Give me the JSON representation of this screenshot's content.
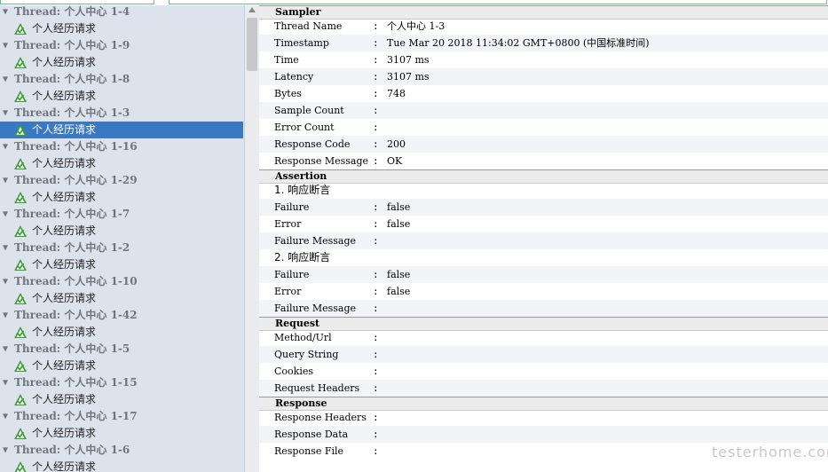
{
  "tree": {
    "rows": [
      {
        "type": "thread",
        "label": "Thread: 个人中心 1-4"
      },
      {
        "type": "request",
        "label": "个人经历请求"
      },
      {
        "type": "thread",
        "label": "Thread: 个人中心 1-9"
      },
      {
        "type": "request",
        "label": "个人经历请求"
      },
      {
        "type": "thread",
        "label": "Thread: 个人中心 1-8"
      },
      {
        "type": "request",
        "label": "个人经历请求"
      },
      {
        "type": "thread",
        "label": "Thread: 个人中心 1-3"
      },
      {
        "type": "request",
        "label": "个人经历请求",
        "selected": true
      },
      {
        "type": "thread",
        "label": "Thread: 个人中心 1-16"
      },
      {
        "type": "request",
        "label": "个人经历请求"
      },
      {
        "type": "thread",
        "label": "Thread: 个人中心 1-29"
      },
      {
        "type": "request",
        "label": "个人经历请求"
      },
      {
        "type": "thread",
        "label": "Thread: 个人中心 1-7"
      },
      {
        "type": "request",
        "label": "个人经历请求"
      },
      {
        "type": "thread",
        "label": "Thread: 个人中心 1-2"
      },
      {
        "type": "request",
        "label": "个人经历请求"
      },
      {
        "type": "thread",
        "label": "Thread: 个人中心 1-10"
      },
      {
        "type": "request",
        "label": "个人经历请求"
      },
      {
        "type": "thread",
        "label": "Thread: 个人中心 1-42"
      },
      {
        "type": "request",
        "label": "个人经历请求"
      },
      {
        "type": "thread",
        "label": "Thread: 个人中心 1-5"
      },
      {
        "type": "request",
        "label": "个人经历请求"
      },
      {
        "type": "thread",
        "label": "Thread: 个人中心 1-15"
      },
      {
        "type": "request",
        "label": "个人经历请求"
      },
      {
        "type": "thread",
        "label": "Thread: 个人中心 1-17"
      },
      {
        "type": "request",
        "label": "个人经历请求"
      },
      {
        "type": "thread",
        "label": "Thread: 个人中心 1-6"
      },
      {
        "type": "request",
        "label": "个人经历请求"
      }
    ],
    "icons": {
      "thread": "collapse-arrow-icon",
      "request": "sample-success-icon"
    },
    "colors": {
      "selected_bg": "#3a78c2",
      "panel_bg": "#dde3ec",
      "success_icon": "#3f9b3a"
    }
  },
  "details": {
    "sections": [
      {
        "title": "Sampler",
        "rows": [
          {
            "key": "Thread Name",
            "value": "个人中心 1-3"
          },
          {
            "key": "Timestamp",
            "value": "Tue Mar 20 2018 11:34:02 GMT+0800 (中国标准时间)"
          },
          {
            "key": "Time",
            "value": "3107 ms"
          },
          {
            "key": "Latency",
            "value": "3107 ms"
          },
          {
            "key": "Bytes",
            "value": "748"
          },
          {
            "key": "Sample Count",
            "value": ""
          },
          {
            "key": "Error Count",
            "value": ""
          },
          {
            "key": "Response Code",
            "value": "200"
          },
          {
            "key": "Response Message",
            "value": "OK"
          }
        ]
      },
      {
        "title": "Assertion",
        "rows": [
          {
            "sub": "1. 响应断言"
          },
          {
            "key": "Failure",
            "value": "false"
          },
          {
            "key": "Error",
            "value": "false"
          },
          {
            "key": "Failure Message",
            "value": ""
          },
          {
            "sub": "2. 响应断言"
          },
          {
            "key": "Failure",
            "value": "false"
          },
          {
            "key": "Error",
            "value": "false"
          },
          {
            "key": "Failure Message",
            "value": ""
          }
        ]
      },
      {
        "title": "Request",
        "rows": [
          {
            "key": "Method/Url",
            "value": ""
          },
          {
            "key": "Query String",
            "value": ""
          },
          {
            "key": "Cookies",
            "value": ""
          },
          {
            "key": "Request Headers",
            "value": ""
          }
        ]
      },
      {
        "title": "Response",
        "rows": [
          {
            "key": "Response Headers",
            "value": ""
          },
          {
            "key": "Response Data",
            "value": ""
          },
          {
            "key": "Response File",
            "value": ""
          }
        ]
      }
    ],
    "colon": ":"
  },
  "watermark": "testerhome.com"
}
